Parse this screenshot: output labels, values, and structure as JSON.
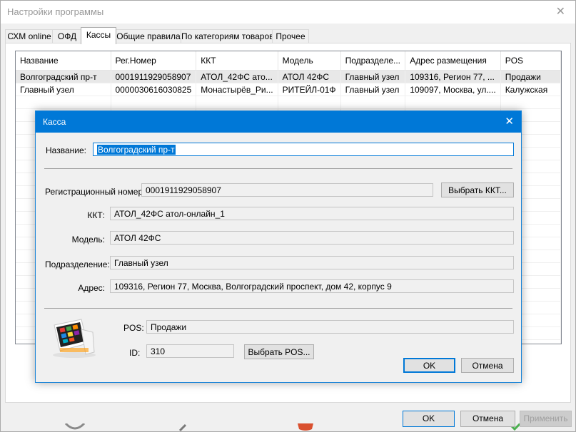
{
  "window": {
    "title": "Настройки программы"
  },
  "tabs": [
    {
      "label": "СХМ online"
    },
    {
      "label": "ОФД"
    },
    {
      "label": "Кассы"
    },
    {
      "label": "Общие правила"
    },
    {
      "label": "По категориям товаров"
    },
    {
      "label": "Прочее"
    }
  ],
  "grid": {
    "columns": [
      "Название",
      "Рег.Номер",
      "ККТ",
      "Модель",
      "Подразделе...",
      "Адрес размещения",
      "POS"
    ],
    "rows": [
      [
        "Волгоградский пр-т",
        "0001911929058907",
        "АТОЛ_42ФС ато...",
        "АТОЛ 42ФС",
        "Главный узел",
        "109316, Регион 77, ...",
        "Продажи"
      ],
      [
        "Главный узел",
        "0000030616030825",
        "Монастырёв_Ри...",
        "РИТЕЙЛ-01Ф",
        "Главный узел",
        "109097, Москва, ул....",
        "Калужская"
      ]
    ]
  },
  "buttons": {
    "ok": "OK",
    "cancel": "Отмена",
    "apply": "Применить"
  },
  "dialog": {
    "title": "Касса",
    "name_label": "Название:",
    "name_value": "Волгоградский пр-т",
    "reg_label": "Регистрационный номер:",
    "reg_value": "0001911929058907",
    "select_kkt": "Выбрать ККТ...",
    "kkt_label": "ККТ:",
    "kkt_value": "АТОЛ_42ФС атол-онлайн_1",
    "model_label": "Модель:",
    "model_value": "АТОЛ 42ФС",
    "dept_label": "Подразделение:",
    "dept_value": "Главный узел",
    "addr_label": "Адрес:",
    "addr_value": "109316, Регион 77, Москва, Волгоградский проспект, дом 42, корпус 9",
    "pos_label": "POS:",
    "pos_value": "Продажи",
    "id_label": "ID:",
    "id_value": "310",
    "select_pos": "Выбрать POS...",
    "ok": "OK",
    "cancel": "Отмена"
  },
  "colors": {
    "accent": "#0078d7",
    "selection_row": "#e8e8e8"
  }
}
